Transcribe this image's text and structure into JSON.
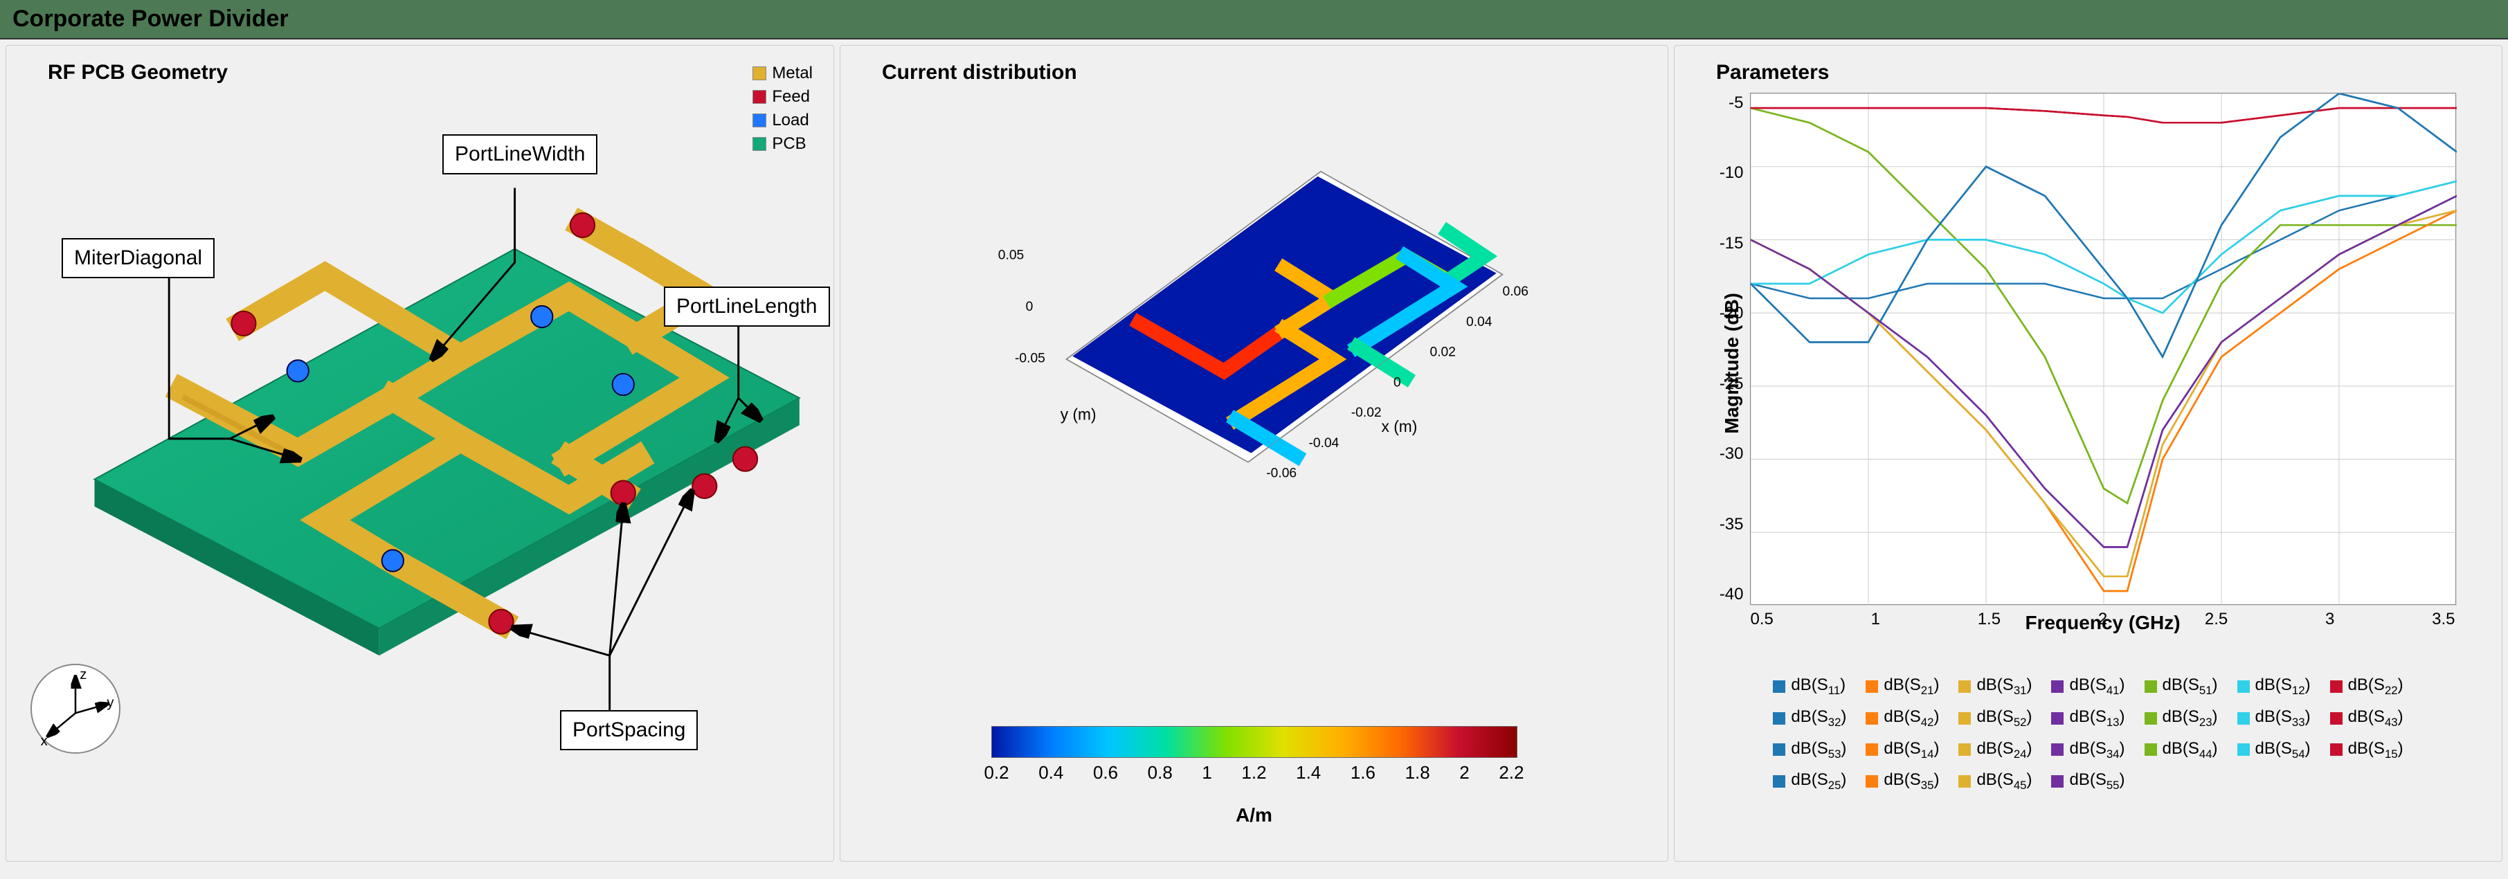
{
  "title": "Corporate Power Divider",
  "panel1": {
    "title": "RF PCB Geometry",
    "legend": [
      {
        "label": "Metal",
        "color": "#e0b030"
      },
      {
        "label": "Feed",
        "color": "#c8102e"
      },
      {
        "label": "Load",
        "color": "#1f77ff"
      },
      {
        "label": "PCB",
        "color": "#12a87a"
      }
    ],
    "callouts": {
      "miter": "MiterDiagonal",
      "portwidth": "PortLineWidth",
      "portlength": "PortLineLength",
      "portspacing": "PortSpacing"
    },
    "axes": {
      "x": "x",
      "y": "y",
      "z": "z"
    }
  },
  "panel2": {
    "title": "Current distribution",
    "xlabel": "x (m)",
    "ylabel": "y (m)",
    "xticks": [
      "-0.06",
      "-0.04",
      "-0.02",
      "0",
      "0.02",
      "0.04",
      "0.06"
    ],
    "yticks": [
      "-0.05",
      "0",
      "0.05"
    ],
    "colorbar_ticks": [
      "0.2",
      "0.4",
      "0.6",
      "0.8",
      "1",
      "1.2",
      "1.4",
      "1.6",
      "1.8",
      "2",
      "2.2"
    ],
    "colorbar_label": "A/m"
  },
  "panel3": {
    "title": "Parameters",
    "ylabel": "Magnitude (dB)",
    "xlabel": "Frequency (GHz)",
    "legend": [
      {
        "label": "dB(S",
        "sub": "11",
        "color": "#1f77b4"
      },
      {
        "label": "dB(S",
        "sub": "21",
        "color": "#ff7f0e"
      },
      {
        "label": "dB(S",
        "sub": "31",
        "color": "#e0b030"
      },
      {
        "label": "dB(S",
        "sub": "41",
        "color": "#7030a0"
      },
      {
        "label": "dB(S",
        "sub": "51",
        "color": "#7ab51d"
      },
      {
        "label": "dB(S",
        "sub": "12",
        "color": "#2fd0e8"
      },
      {
        "label": "dB(S",
        "sub": "22",
        "color": "#c8102e"
      },
      {
        "label": "dB(S",
        "sub": "32",
        "color": "#1f77b4"
      },
      {
        "label": "dB(S",
        "sub": "42",
        "color": "#ff7f0e"
      },
      {
        "label": "dB(S",
        "sub": "52",
        "color": "#e0b030"
      },
      {
        "label": "dB(S",
        "sub": "13",
        "color": "#7030a0"
      },
      {
        "label": "dB(S",
        "sub": "23",
        "color": "#7ab51d"
      },
      {
        "label": "dB(S",
        "sub": "33",
        "color": "#2fd0e8"
      },
      {
        "label": "dB(S",
        "sub": "43",
        "color": "#c8102e"
      },
      {
        "label": "dB(S",
        "sub": "53",
        "color": "#1f77b4"
      },
      {
        "label": "dB(S",
        "sub": "14",
        "color": "#ff7f0e"
      },
      {
        "label": "dB(S",
        "sub": "24",
        "color": "#e0b030"
      },
      {
        "label": "dB(S",
        "sub": "34",
        "color": "#7030a0"
      },
      {
        "label": "dB(S",
        "sub": "44",
        "color": "#7ab51d"
      },
      {
        "label": "dB(S",
        "sub": "54",
        "color": "#2fd0e8"
      },
      {
        "label": "dB(S",
        "sub": "15",
        "color": "#c8102e"
      },
      {
        "label": "dB(S",
        "sub": "25",
        "color": "#1f77b4"
      },
      {
        "label": "dB(S",
        "sub": "35",
        "color": "#ff7f0e"
      },
      {
        "label": "dB(S",
        "sub": "45",
        "color": "#e0b030"
      },
      {
        "label": "dB(S",
        "sub": "55",
        "color": "#7030a0"
      }
    ]
  },
  "chart_data": {
    "type": "line",
    "title": "Parameters",
    "xlabel": "Frequency (GHz)",
    "ylabel": "Magnitude (dB)",
    "xlim": [
      0.5,
      3.5
    ],
    "ylim": [
      -40,
      -5
    ],
    "xticks": [
      0.5,
      1,
      1.5,
      2,
      2.5,
      3,
      3.5
    ],
    "yticks": [
      -40,
      -35,
      -30,
      -25,
      -20,
      -15,
      -10,
      -5
    ],
    "x": [
      0.5,
      0.75,
      1.0,
      1.25,
      1.5,
      1.75,
      2.0,
      2.1,
      2.25,
      2.5,
      2.75,
      3.0,
      3.25,
      3.5
    ],
    "series": [
      {
        "name": "dB(S11)",
        "color": "#1f77b4",
        "values": [
          -18,
          -22,
          -22,
          -15,
          -10,
          -12,
          -17,
          -19,
          -23,
          -14,
          -8,
          -5,
          -6,
          -9
        ]
      },
      {
        "name": "dB(S21)",
        "color": "#ff7f0e",
        "values": [
          -15,
          -17,
          -20,
          -24,
          -28,
          -33,
          -39,
          -39,
          -30,
          -23,
          -20,
          -17,
          -15,
          -13
        ]
      },
      {
        "name": "dB(S31)",
        "color": "#e0b030",
        "values": [
          -15,
          -17,
          -20,
          -24,
          -28,
          -33,
          -38,
          -38,
          -29,
          -22,
          -19,
          -16,
          -14,
          -12
        ]
      },
      {
        "name": "dB(S41)",
        "color": "#7030a0",
        "values": [
          -15,
          -17,
          -20,
          -23,
          -27,
          -32,
          -36,
          -36,
          -28,
          -22,
          -19,
          -16,
          -14,
          -12
        ]
      },
      {
        "name": "dB(S51)",
        "color": "#7ab51d",
        "values": [
          -6,
          -7,
          -9,
          -13,
          -17,
          -23,
          -32,
          -33,
          -26,
          -18,
          -14,
          -14,
          -14,
          -14
        ]
      },
      {
        "name": "dB(S12)",
        "color": "#2fd0e8",
        "values": [
          -18,
          -18,
          -16,
          -15,
          -15,
          -16,
          -18,
          -19,
          -20,
          -16,
          -13,
          -12,
          -12,
          -11
        ]
      },
      {
        "name": "dB(S22)",
        "color": "#c8102e",
        "values": [
          -6,
          -6,
          -6,
          -6,
          -6,
          -6.2,
          -6.5,
          -6.6,
          -7,
          -7,
          -6.5,
          -6,
          -6,
          -6
        ]
      },
      {
        "name": "dB(S32)",
        "color": "#1f77b4",
        "values": [
          -18,
          -19,
          -19,
          -18,
          -18,
          -18,
          -19,
          -19,
          -19,
          -17,
          -15,
          -13,
          -12,
          -11
        ]
      },
      {
        "name": "dB(S42)",
        "color": "#ff7f0e",
        "values": [
          -15,
          -17,
          -20,
          -24,
          -28,
          -33,
          -39,
          -39,
          -30,
          -23,
          -20,
          -17,
          -15,
          -13
        ]
      },
      {
        "name": "dB(S52)",
        "color": "#e0b030",
        "values": [
          -15,
          -17,
          -20,
          -24,
          -28,
          -33,
          -38,
          -38,
          -29,
          -22,
          -19,
          -16,
          -14,
          -13
        ]
      },
      {
        "name": "dB(S13)",
        "color": "#7030a0",
        "values": [
          -15,
          -17,
          -20,
          -23,
          -27,
          -32,
          -36,
          -36,
          -28,
          -22,
          -19,
          -16,
          -14,
          -12
        ]
      },
      {
        "name": "dB(S23)",
        "color": "#7ab51d",
        "values": [
          -6,
          -7,
          -9,
          -13,
          -17,
          -23,
          -32,
          -33,
          -26,
          -18,
          -14,
          -14,
          -14,
          -14
        ]
      },
      {
        "name": "dB(S33)",
        "color": "#2fd0e8",
        "values": [
          -18,
          -18,
          -16,
          -15,
          -15,
          -16,
          -18,
          -19,
          -20,
          -16,
          -13,
          -12,
          -12,
          -11
        ]
      },
      {
        "name": "dB(S43)",
        "color": "#c8102e",
        "values": [
          -6,
          -6,
          -6,
          -6,
          -6,
          -6.2,
          -6.5,
          -6.6,
          -7,
          -7,
          -6.5,
          -6,
          -6,
          -6
        ]
      },
      {
        "name": "dB(S53)",
        "color": "#1f77b4",
        "values": [
          -18,
          -22,
          -22,
          -15,
          -10,
          -12,
          -17,
          -19,
          -23,
          -14,
          -8,
          -5,
          -6,
          -9
        ]
      },
      {
        "name": "dB(S14)",
        "color": "#ff7f0e",
        "values": [
          -15,
          -17,
          -20,
          -24,
          -28,
          -33,
          -39,
          -39,
          -30,
          -23,
          -20,
          -17,
          -15,
          -13
        ]
      },
      {
        "name": "dB(S24)",
        "color": "#e0b030",
        "values": [
          -15,
          -17,
          -20,
          -24,
          -28,
          -33,
          -38,
          -38,
          -29,
          -22,
          -19,
          -16,
          -14,
          -13
        ]
      },
      {
        "name": "dB(S34)",
        "color": "#7030a0",
        "values": [
          -15,
          -17,
          -20,
          -23,
          -27,
          -32,
          -36,
          -36,
          -28,
          -22,
          -19,
          -16,
          -14,
          -12
        ]
      },
      {
        "name": "dB(S44)",
        "color": "#7ab51d",
        "values": [
          -6,
          -7,
          -9,
          -13,
          -17,
          -23,
          -32,
          -33,
          -26,
          -18,
          -14,
          -14,
          -14,
          -14
        ]
      },
      {
        "name": "dB(S54)",
        "color": "#2fd0e8",
        "values": [
          -18,
          -18,
          -16,
          -15,
          -15,
          -16,
          -18,
          -19,
          -20,
          -16,
          -13,
          -12,
          -12,
          -11
        ]
      },
      {
        "name": "dB(S15)",
        "color": "#c8102e",
        "values": [
          -6,
          -6,
          -6,
          -6,
          -6,
          -6.2,
          -6.5,
          -6.6,
          -7,
          -7,
          -6.5,
          -6,
          -6,
          -6
        ]
      },
      {
        "name": "dB(S25)",
        "color": "#1f77b4",
        "values": [
          -18,
          -22,
          -22,
          -15,
          -10,
          -12,
          -17,
          -19,
          -23,
          -14,
          -8,
          -5,
          -6,
          -9
        ]
      },
      {
        "name": "dB(S35)",
        "color": "#ff7f0e",
        "values": [
          -15,
          -17,
          -20,
          -24,
          -28,
          -33,
          -39,
          -39,
          -30,
          -23,
          -20,
          -17,
          -15,
          -13
        ]
      },
      {
        "name": "dB(S45)",
        "color": "#e0b030",
        "values": [
          -15,
          -17,
          -20,
          -24,
          -28,
          -33,
          -38,
          -38,
          -29,
          -22,
          -19,
          -16,
          -14,
          -13
        ]
      },
      {
        "name": "dB(S55)",
        "color": "#7030a0",
        "values": [
          -15,
          -17,
          -20,
          -23,
          -27,
          -32,
          -36,
          -36,
          -28,
          -22,
          -19,
          -16,
          -14,
          -12
        ]
      }
    ]
  }
}
